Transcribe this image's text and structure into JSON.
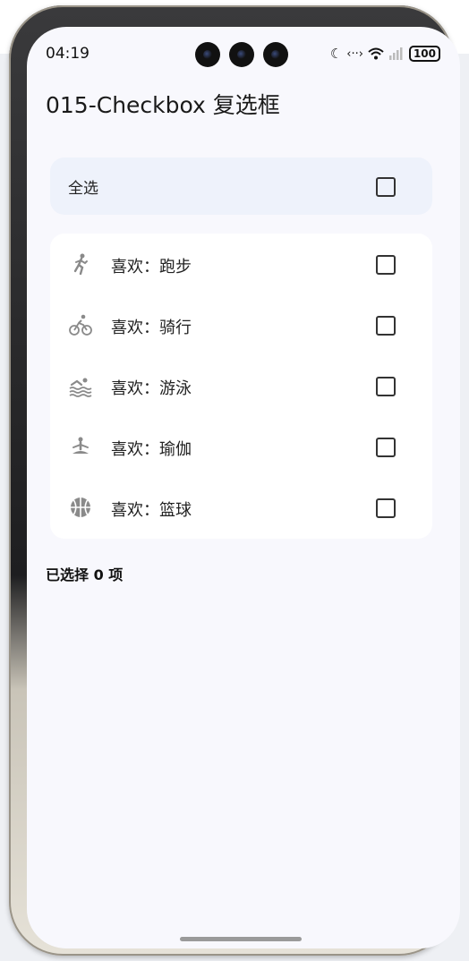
{
  "status_bar": {
    "time": "04:19",
    "battery": "100"
  },
  "page": {
    "title": "015-Checkbox 复选框"
  },
  "select_all": {
    "label": "全选",
    "checked": false
  },
  "items": [
    {
      "label": "喜欢：跑步",
      "icon": "running-icon",
      "checked": false
    },
    {
      "label": "喜欢：骑行",
      "icon": "cycling-icon",
      "checked": false
    },
    {
      "label": "喜欢：游泳",
      "icon": "swimming-icon",
      "checked": false
    },
    {
      "label": "喜欢：瑜伽",
      "icon": "yoga-icon",
      "checked": false
    },
    {
      "label": "喜欢：篮球",
      "icon": "basketball-icon",
      "checked": false
    }
  ],
  "summary": {
    "text": "已选择 0 项"
  },
  "colors": {
    "screen_bg": "#f8f8fd",
    "select_all_bg": "#eef2fb",
    "icon_gray": "#8a8a8a"
  }
}
